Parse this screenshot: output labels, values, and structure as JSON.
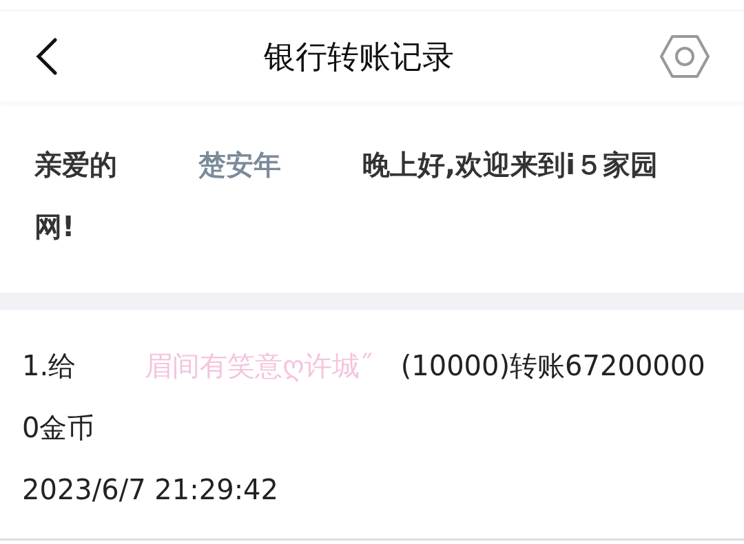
{
  "header": {
    "title": "银行转账记录"
  },
  "greeting": {
    "prefix": "亲爱的",
    "name": "楚安年",
    "suffix": "晚上好,欢迎来到i５家园网!"
  },
  "records": [
    {
      "label": "1.给",
      "recipient": "眉间有笑意ღ许城˝",
      "detail": "(10000)转账672000000金币",
      "time": "2023/6/7 21:29:42"
    }
  ]
}
